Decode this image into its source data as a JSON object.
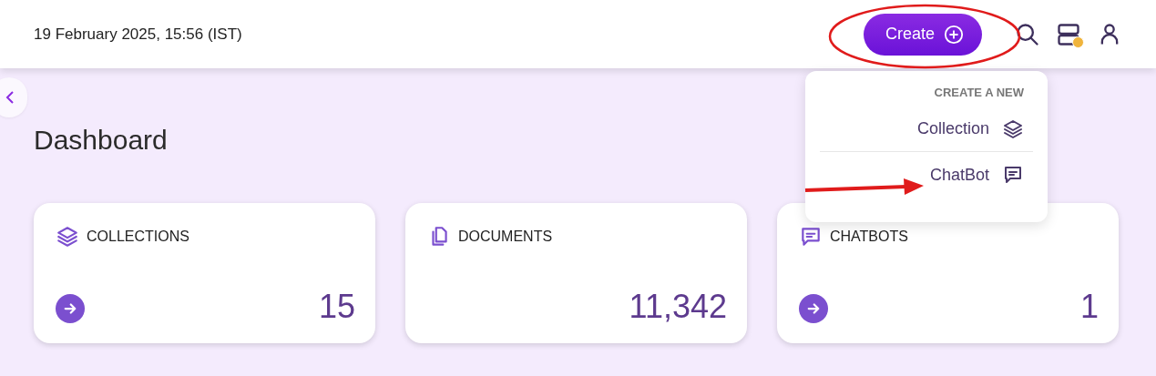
{
  "header": {
    "datetime": "19 February 2025, 15:56 (IST)",
    "create_button": "Create",
    "notification_dot": true
  },
  "create_menu": {
    "heading": "CREATE A NEW",
    "items": [
      {
        "label": "Collection",
        "kind": "layers"
      },
      {
        "label": "ChatBot",
        "kind": "chat"
      }
    ]
  },
  "page": {
    "title": "Dashboard"
  },
  "cards": [
    {
      "label": "COLLECTIONS",
      "kind": "layers",
      "value": "15",
      "has_link": true
    },
    {
      "label": "DOCUMENTS",
      "kind": "documents",
      "value": "11,342",
      "has_link": false
    },
    {
      "label": "CHATBOTS",
      "kind": "chat",
      "value": "1",
      "has_link": true
    }
  ]
}
